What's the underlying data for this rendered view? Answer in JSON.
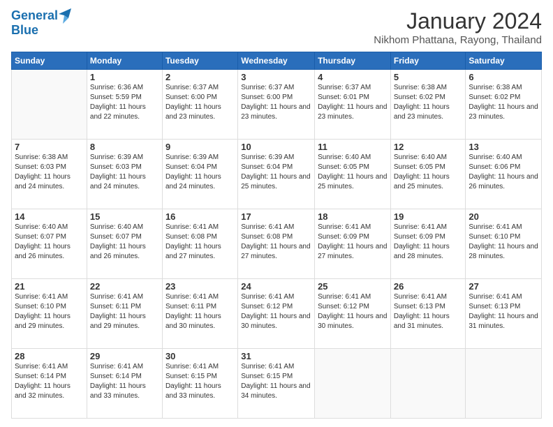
{
  "logo": {
    "line1": "General",
    "line2": "Blue"
  },
  "title": "January 2024",
  "subtitle": "Nikhom Phattana, Rayong, Thailand",
  "days_of_week": [
    "Sunday",
    "Monday",
    "Tuesday",
    "Wednesday",
    "Thursday",
    "Friday",
    "Saturday"
  ],
  "weeks": [
    [
      {
        "day": "",
        "info": ""
      },
      {
        "day": "1",
        "info": "Sunrise: 6:36 AM\nSunset: 5:59 PM\nDaylight: 11 hours\nand 22 minutes."
      },
      {
        "day": "2",
        "info": "Sunrise: 6:37 AM\nSunset: 6:00 PM\nDaylight: 11 hours\nand 23 minutes."
      },
      {
        "day": "3",
        "info": "Sunrise: 6:37 AM\nSunset: 6:00 PM\nDaylight: 11 hours\nand 23 minutes."
      },
      {
        "day": "4",
        "info": "Sunrise: 6:37 AM\nSunset: 6:01 PM\nDaylight: 11 hours\nand 23 minutes."
      },
      {
        "day": "5",
        "info": "Sunrise: 6:38 AM\nSunset: 6:02 PM\nDaylight: 11 hours\nand 23 minutes."
      },
      {
        "day": "6",
        "info": "Sunrise: 6:38 AM\nSunset: 6:02 PM\nDaylight: 11 hours\nand 23 minutes."
      }
    ],
    [
      {
        "day": "7",
        "info": "Sunrise: 6:38 AM\nSunset: 6:03 PM\nDaylight: 11 hours\nand 24 minutes."
      },
      {
        "day": "8",
        "info": "Sunrise: 6:39 AM\nSunset: 6:03 PM\nDaylight: 11 hours\nand 24 minutes."
      },
      {
        "day": "9",
        "info": "Sunrise: 6:39 AM\nSunset: 6:04 PM\nDaylight: 11 hours\nand 24 minutes."
      },
      {
        "day": "10",
        "info": "Sunrise: 6:39 AM\nSunset: 6:04 PM\nDaylight: 11 hours\nand 25 minutes."
      },
      {
        "day": "11",
        "info": "Sunrise: 6:40 AM\nSunset: 6:05 PM\nDaylight: 11 hours\nand 25 minutes."
      },
      {
        "day": "12",
        "info": "Sunrise: 6:40 AM\nSunset: 6:05 PM\nDaylight: 11 hours\nand 25 minutes."
      },
      {
        "day": "13",
        "info": "Sunrise: 6:40 AM\nSunset: 6:06 PM\nDaylight: 11 hours\nand 26 minutes."
      }
    ],
    [
      {
        "day": "14",
        "info": "Sunrise: 6:40 AM\nSunset: 6:07 PM\nDaylight: 11 hours\nand 26 minutes."
      },
      {
        "day": "15",
        "info": "Sunrise: 6:40 AM\nSunset: 6:07 PM\nDaylight: 11 hours\nand 26 minutes."
      },
      {
        "day": "16",
        "info": "Sunrise: 6:41 AM\nSunset: 6:08 PM\nDaylight: 11 hours\nand 27 minutes."
      },
      {
        "day": "17",
        "info": "Sunrise: 6:41 AM\nSunset: 6:08 PM\nDaylight: 11 hours\nand 27 minutes."
      },
      {
        "day": "18",
        "info": "Sunrise: 6:41 AM\nSunset: 6:09 PM\nDaylight: 11 hours\nand 27 minutes."
      },
      {
        "day": "19",
        "info": "Sunrise: 6:41 AM\nSunset: 6:09 PM\nDaylight: 11 hours\nand 28 minutes."
      },
      {
        "day": "20",
        "info": "Sunrise: 6:41 AM\nSunset: 6:10 PM\nDaylight: 11 hours\nand 28 minutes."
      }
    ],
    [
      {
        "day": "21",
        "info": "Sunrise: 6:41 AM\nSunset: 6:10 PM\nDaylight: 11 hours\nand 29 minutes."
      },
      {
        "day": "22",
        "info": "Sunrise: 6:41 AM\nSunset: 6:11 PM\nDaylight: 11 hours\nand 29 minutes."
      },
      {
        "day": "23",
        "info": "Sunrise: 6:41 AM\nSunset: 6:11 PM\nDaylight: 11 hours\nand 30 minutes."
      },
      {
        "day": "24",
        "info": "Sunrise: 6:41 AM\nSunset: 6:12 PM\nDaylight: 11 hours\nand 30 minutes."
      },
      {
        "day": "25",
        "info": "Sunrise: 6:41 AM\nSunset: 6:12 PM\nDaylight: 11 hours\nand 30 minutes."
      },
      {
        "day": "26",
        "info": "Sunrise: 6:41 AM\nSunset: 6:13 PM\nDaylight: 11 hours\nand 31 minutes."
      },
      {
        "day": "27",
        "info": "Sunrise: 6:41 AM\nSunset: 6:13 PM\nDaylight: 11 hours\nand 31 minutes."
      }
    ],
    [
      {
        "day": "28",
        "info": "Sunrise: 6:41 AM\nSunset: 6:14 PM\nDaylight: 11 hours\nand 32 minutes."
      },
      {
        "day": "29",
        "info": "Sunrise: 6:41 AM\nSunset: 6:14 PM\nDaylight: 11 hours\nand 33 minutes."
      },
      {
        "day": "30",
        "info": "Sunrise: 6:41 AM\nSunset: 6:15 PM\nDaylight: 11 hours\nand 33 minutes."
      },
      {
        "day": "31",
        "info": "Sunrise: 6:41 AM\nSunset: 6:15 PM\nDaylight: 11 hours\nand 34 minutes."
      },
      {
        "day": "",
        "info": ""
      },
      {
        "day": "",
        "info": ""
      },
      {
        "day": "",
        "info": ""
      }
    ]
  ]
}
